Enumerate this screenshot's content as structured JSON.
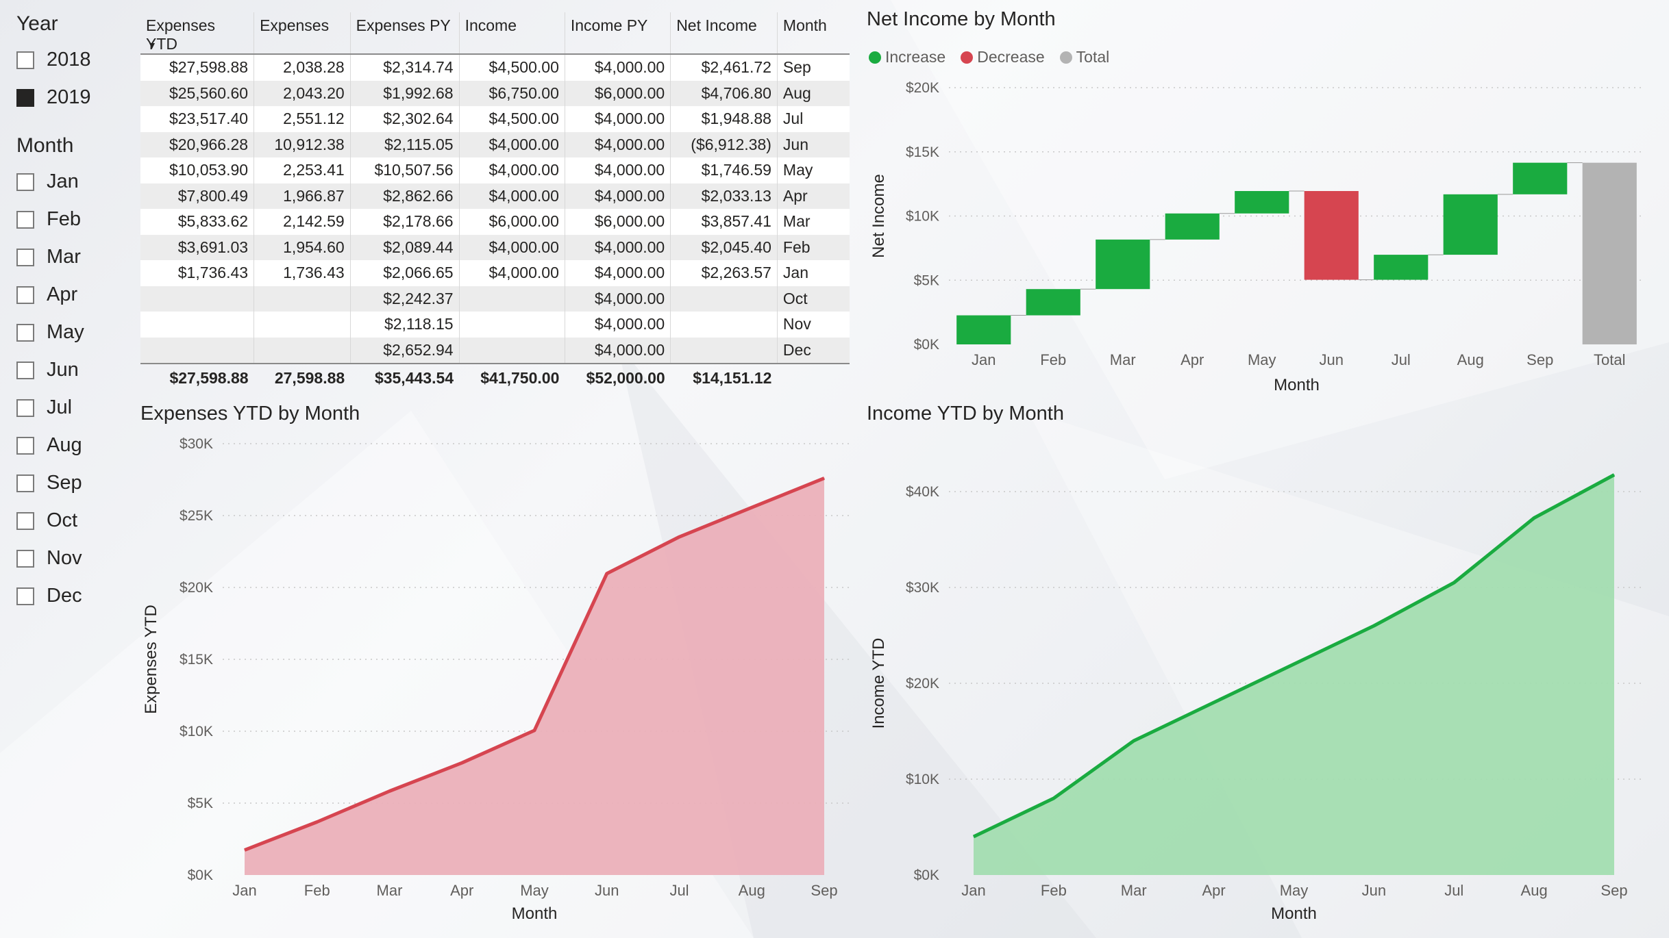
{
  "slicers": {
    "year": {
      "title": "Year",
      "items": [
        {
          "label": "2018",
          "checked": false
        },
        {
          "label": "2019",
          "checked": true
        }
      ]
    },
    "month": {
      "title": "Month",
      "items": [
        {
          "label": "Jan",
          "checked": false
        },
        {
          "label": "Feb",
          "checked": false
        },
        {
          "label": "Mar",
          "checked": false
        },
        {
          "label": "Apr",
          "checked": false
        },
        {
          "label": "May",
          "checked": false
        },
        {
          "label": "Jun",
          "checked": false
        },
        {
          "label": "Jul",
          "checked": false
        },
        {
          "label": "Aug",
          "checked": false
        },
        {
          "label": "Sep",
          "checked": false
        },
        {
          "label": "Oct",
          "checked": false
        },
        {
          "label": "Nov",
          "checked": false
        },
        {
          "label": "Dec",
          "checked": false
        }
      ]
    }
  },
  "table": {
    "columns": [
      "Expenses YTD",
      "Expenses",
      "Expenses PY",
      "Income",
      "Income PY",
      "Net Income",
      "Month"
    ],
    "rows": [
      [
        "$27,598.88",
        "2,038.28",
        "$2,314.74",
        "$4,500.00",
        "$4,000.00",
        "$2,461.72",
        "Sep"
      ],
      [
        "$25,560.60",
        "2,043.20",
        "$1,992.68",
        "$6,750.00",
        "$6,000.00",
        "$4,706.80",
        "Aug"
      ],
      [
        "$23,517.40",
        "2,551.12",
        "$2,302.64",
        "$4,500.00",
        "$4,000.00",
        "$1,948.88",
        "Jul"
      ],
      [
        "$20,966.28",
        "10,912.38",
        "$2,115.05",
        "$4,000.00",
        "$4,000.00",
        "($6,912.38)",
        "Jun"
      ],
      [
        "$10,053.90",
        "2,253.41",
        "$10,507.56",
        "$4,000.00",
        "$4,000.00",
        "$1,746.59",
        "May"
      ],
      [
        "$7,800.49",
        "1,966.87",
        "$2,862.66",
        "$4,000.00",
        "$4,000.00",
        "$2,033.13",
        "Apr"
      ],
      [
        "$5,833.62",
        "2,142.59",
        "$2,178.66",
        "$6,000.00",
        "$6,000.00",
        "$3,857.41",
        "Mar"
      ],
      [
        "$3,691.03",
        "1,954.60",
        "$2,089.44",
        "$4,000.00",
        "$4,000.00",
        "$2,045.40",
        "Feb"
      ],
      [
        "$1,736.43",
        "1,736.43",
        "$2,066.65",
        "$4,000.00",
        "$4,000.00",
        "$2,263.57",
        "Jan"
      ],
      [
        "",
        "",
        "$2,242.37",
        "",
        "$4,000.00",
        "",
        "Oct"
      ],
      [
        "",
        "",
        "$2,118.15",
        "",
        "$4,000.00",
        "",
        "Nov"
      ],
      [
        "",
        "",
        "$2,652.94",
        "",
        "$4,000.00",
        "",
        "Dec"
      ]
    ],
    "totals": [
      "$27,598.88",
      "27,598.88",
      "$35,443.54",
      "$41,750.00",
      "$52,000.00",
      "$14,151.12",
      ""
    ]
  },
  "chart_data": [
    {
      "type": "waterfall",
      "title": "Net Income by Month",
      "xlabel": "Month",
      "ylabel": "Net Income",
      "categories": [
        "Jan",
        "Feb",
        "Mar",
        "Apr",
        "May",
        "Jun",
        "Jul",
        "Aug",
        "Sep",
        "Total"
      ],
      "values": [
        2263.57,
        2045.4,
        3857.41,
        2033.13,
        1746.59,
        -6912.38,
        1948.88,
        4706.8,
        2461.72,
        14151.12
      ],
      "ylim": [
        0,
        20000
      ],
      "yticks": [
        "$0K",
        "$5K",
        "$10K",
        "$15K",
        "$20K"
      ],
      "legend": {
        "position": "top-left",
        "items": [
          {
            "label": "Increase",
            "color": "#1aab40"
          },
          {
            "label": "Decrease",
            "color": "#d64550"
          },
          {
            "label": "Total",
            "color": "#b3b3b3"
          }
        ]
      },
      "grid": true
    },
    {
      "type": "area",
      "title": "Expenses YTD by Month",
      "xlabel": "Month",
      "ylabel": "Expenses YTD",
      "categories": [
        "Jan",
        "Feb",
        "Mar",
        "Apr",
        "May",
        "Jun",
        "Jul",
        "Aug",
        "Sep"
      ],
      "values": [
        1736.43,
        3691.03,
        5833.62,
        7800.49,
        10053.9,
        20966.28,
        23517.4,
        25560.6,
        27598.88
      ],
      "ylim": [
        0,
        30000
      ],
      "yticks": [
        "$0K",
        "$5K",
        "$10K",
        "$15K",
        "$20K",
        "$25K",
        "$30K"
      ],
      "line_color": "#d64550",
      "fill_color": "#ebb0b9",
      "grid": true
    },
    {
      "type": "area",
      "title": "Income YTD by Month",
      "xlabel": "Month",
      "ylabel": "Income YTD",
      "categories": [
        "Jan",
        "Feb",
        "Mar",
        "Apr",
        "May",
        "Jun",
        "Jul",
        "Aug",
        "Sep"
      ],
      "values": [
        4000,
        8000,
        14000,
        18000,
        22000,
        26000,
        30500,
        37250,
        41750
      ],
      "ylim": [
        0,
        40000
      ],
      "yticks": [
        "$0K",
        "$10K",
        "$20K",
        "$30K",
        "$40K"
      ],
      "line_color": "#1aab40",
      "fill_color": "#a3ddb0",
      "grid": true
    }
  ]
}
